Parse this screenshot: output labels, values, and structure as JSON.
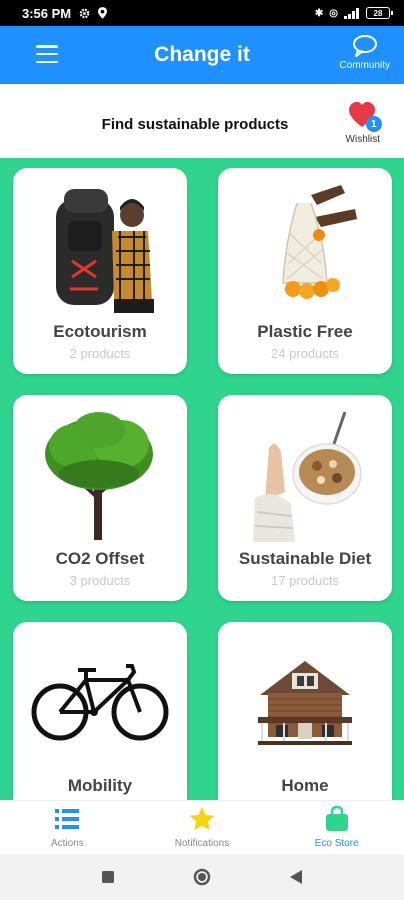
{
  "status": {
    "time": "3:56 PM",
    "battery": "28"
  },
  "app_bar": {
    "title": "Change it",
    "community_label": "Community"
  },
  "subheader": {
    "title": "Find sustainable products",
    "wishlist_label": "Wishlist",
    "wishlist_count": "1"
  },
  "categories": [
    {
      "title": "Ecotourism",
      "count": "2 products"
    },
    {
      "title": "Plastic Free",
      "count": "24 products"
    },
    {
      "title": "CO2 Offset",
      "count": "3 products"
    },
    {
      "title": "Sustainable Diet",
      "count": "17 products"
    },
    {
      "title": "Mobility",
      "count": ""
    },
    {
      "title": "Home",
      "count": ""
    }
  ],
  "bottom_nav": [
    {
      "label": "Actions",
      "icon": "list-icon"
    },
    {
      "label": "Notifications",
      "icon": "star-icon"
    },
    {
      "label": "Eco Store",
      "icon": "shopping-bag-icon",
      "active": true
    }
  ],
  "colors": {
    "primary": "#1e90ff",
    "background": "#2fd48f",
    "heart": "#e53946",
    "star": "#f5d40f",
    "store": "#2fd48f"
  }
}
